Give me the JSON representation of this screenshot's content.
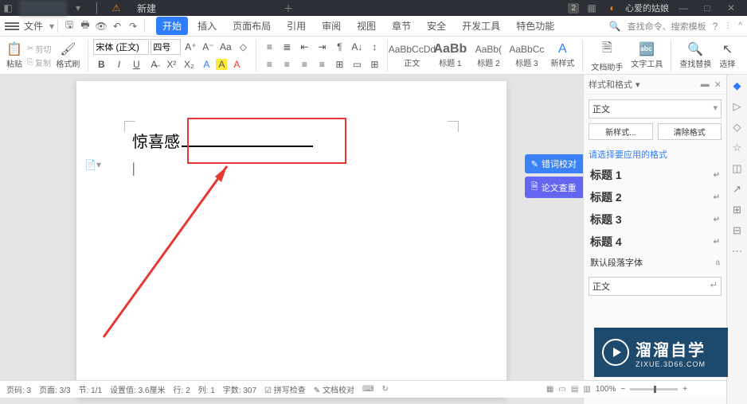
{
  "titlebar": {
    "tab_new": "新建",
    "badge": "2",
    "user": "心爱的姑娘"
  },
  "menubar": {
    "file": "文件",
    "tabs": {
      "start": "开始",
      "insert": "插入",
      "layout": "页面布局",
      "reference": "引用",
      "review": "审阅",
      "view": "视图",
      "section": "章节",
      "security": "安全",
      "developer": "开发工具",
      "special": "特色功能"
    },
    "search": "查找命令、搜索模板"
  },
  "ribbon": {
    "paste": "粘贴",
    "copy": "复制",
    "cut": "剪切",
    "format_painter": "格式刷",
    "font_name": "宋体 (正文)",
    "font_size": "四号",
    "styles": {
      "body": {
        "preview": "AaBbCcDd",
        "label": "正文"
      },
      "h1": {
        "preview": "AaBb",
        "label": "标题 1"
      },
      "h2": {
        "preview": "AaBb(",
        "label": "标题 2"
      },
      "h3": {
        "preview": "AaBbCc",
        "label": "标题 3"
      }
    },
    "new_style": "新样式",
    "doc_helper": "文档助手",
    "text_tools": "文字工具",
    "find_replace": "查找替换",
    "select": "选择"
  },
  "document": {
    "text": "惊喜感",
    "side_tag_1": "错词校对",
    "side_tag_2": "论文查重"
  },
  "stylespane": {
    "title": "样式和格式",
    "current": "正文",
    "new_style": "新样式...",
    "clear": "清除格式",
    "apply_label": "请选择要应用的格式",
    "items": {
      "h1": "标题 1",
      "h2": "标题 2",
      "h3": "标题 3",
      "h4": "标题 4",
      "default_font": "默认段落字体",
      "body": "正文"
    }
  },
  "statusbar": {
    "page_num": "页码: 3",
    "page": "页面: 3/3",
    "section": "节: 1/1",
    "position": "设置值: 3.6厘米",
    "line": "行: 2",
    "col": "列: 1",
    "words": "字数: 307",
    "spell": "拼写检查",
    "doc_check": "文档校对",
    "zoom": "100%"
  },
  "watermark": {
    "main": "溜溜自学",
    "sub": "ZIXUE.3D66.COM"
  }
}
